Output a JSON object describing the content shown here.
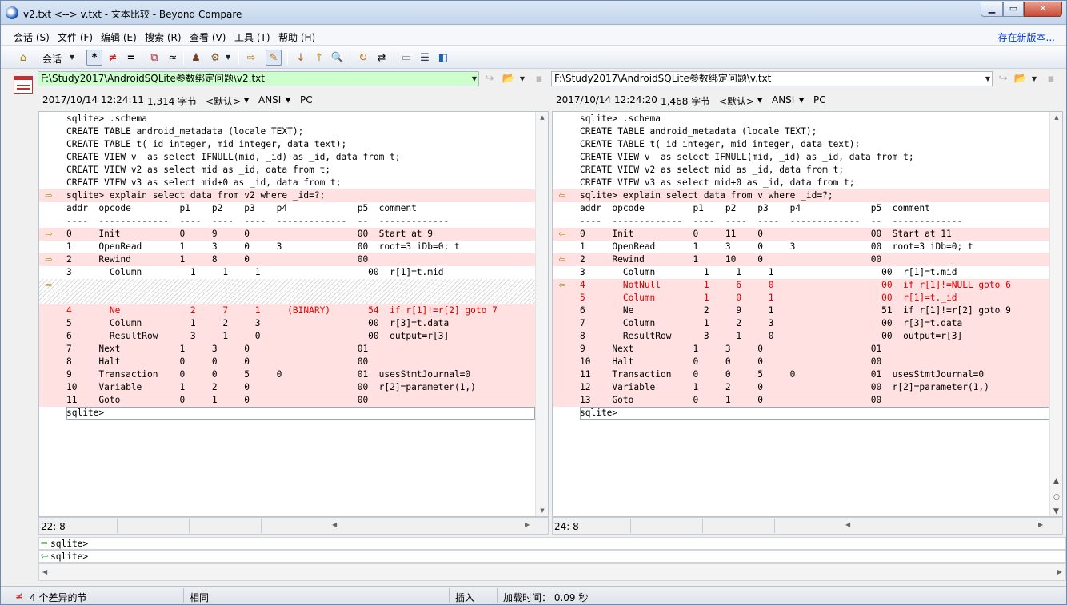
{
  "window": {
    "title": "v2.txt <--> v.txt - 文本比较 - Beyond Compare",
    "minimize": "▁",
    "maximize": "▭",
    "close": "✕"
  },
  "menu": {
    "items": [
      "会话 (S)",
      "文件 (F)",
      "编辑 (E)",
      "搜索 (R)",
      "查看 (V)",
      "工具 (T)",
      "帮助 (H)"
    ],
    "update_link": "存在新版本..."
  },
  "toolbar": {
    "session_label": "会话"
  },
  "left": {
    "path": "F:\\Study2017\\AndroidSQLite参数绑定问题\\v2.txt",
    "date": "2017/10/14 12:24:11",
    "size": "1,314 字节",
    "format": "<默认>",
    "encoding": "ANSI",
    "lineend": "PC",
    "cursor": "22: 8",
    "lines": [
      {
        "text": "sqlite> .schema",
        "cls": "",
        "arrow": ""
      },
      {
        "text": "CREATE TABLE android_metadata (locale TEXT);",
        "cls": "",
        "arrow": ""
      },
      {
        "text": "CREATE TABLE t(_id integer, mid integer, data text);",
        "cls": "",
        "arrow": ""
      },
      {
        "text": "CREATE VIEW v  as select IFNULL(mid, _id) as _id, data from t;",
        "cls": "",
        "arrow": ""
      },
      {
        "text": "CREATE VIEW v2 as select mid as _id, data from t;",
        "cls": "",
        "arrow": ""
      },
      {
        "text": "CREATE VIEW v3 as select mid+0 as _id, data from t;",
        "cls": "",
        "arrow": ""
      },
      {
        "text": "sqlite> explain select data from v2 where _id=?;",
        "cls": "diff",
        "arrow": "⇨"
      },
      {
        "text": "addr  opcode         p1    p2    p3    p4             p5  comment",
        "cls": "",
        "arrow": ""
      },
      {
        "text": "----  -------------  ----  ----  ----  -------------  --  -------------",
        "cls": "",
        "arrow": ""
      },
      {
        "text": "0     Init           0     9     0                    00  Start at 9",
        "cls": "diff",
        "arrow": "⇨"
      },
      {
        "text": "1     OpenRead       1     3     0     3              00  root=3 iDb=0; t",
        "cls": "",
        "arrow": ""
      },
      {
        "text": "2     Rewind         1     8     0                    00",
        "cls": "diff",
        "arrow": "⇨"
      },
      {
        "text": "3       Column         1     1     1                    00  r[1]=t.mid",
        "cls": "",
        "arrow": ""
      },
      {
        "text": "",
        "cls": "hatch",
        "arrow": "⇨"
      },
      {
        "text": "",
        "cls": "hatch",
        "arrow": ""
      },
      {
        "text": "4       Ne             2     7     1     (BINARY)       54  if r[1]!=r[2] goto 7",
        "cls": "diff red",
        "arrow": ""
      },
      {
        "text": "5       Column         1     2     3                    00  r[3]=t.data",
        "cls": "diff",
        "arrow": ""
      },
      {
        "text": "6       ResultRow      3     1     0                    00  output=r[3]",
        "cls": "diff",
        "arrow": ""
      },
      {
        "text": "7     Next           1     3     0                    01",
        "cls": "diff",
        "arrow": ""
      },
      {
        "text": "8     Halt           0     0     0                    00",
        "cls": "diff",
        "arrow": ""
      },
      {
        "text": "9     Transaction    0     0     5     0              01  usesStmtJournal=0",
        "cls": "diff",
        "arrow": ""
      },
      {
        "text": "10    Variable       1     2     0                    00  r[2]=parameter(1,)",
        "cls": "diff",
        "arrow": ""
      },
      {
        "text": "11    Goto           0     1     0                    00",
        "cls": "diff",
        "arrow": ""
      },
      {
        "text": "sqlite>",
        "cls": "cur",
        "arrow": ""
      }
    ]
  },
  "right": {
    "path": "F:\\Study2017\\AndroidSQLite参数绑定问题\\v.txt",
    "date": "2017/10/14 12:24:20",
    "size": "1,468 字节",
    "format": "<默认>",
    "encoding": "ANSI",
    "lineend": "PC",
    "cursor": "24: 8",
    "lines": [
      {
        "text": "sqlite> .schema",
        "cls": "",
        "arrow": ""
      },
      {
        "text": "CREATE TABLE android_metadata (locale TEXT);",
        "cls": "",
        "arrow": ""
      },
      {
        "text": "CREATE TABLE t(_id integer, mid integer, data text);",
        "cls": "",
        "arrow": ""
      },
      {
        "text": "CREATE VIEW v  as select IFNULL(mid, _id) as _id, data from t;",
        "cls": "",
        "arrow": ""
      },
      {
        "text": "CREATE VIEW v2 as select mid as _id, data from t;",
        "cls": "",
        "arrow": ""
      },
      {
        "text": "CREATE VIEW v3 as select mid+0 as _id, data from t;",
        "cls": "",
        "arrow": ""
      },
      {
        "text": "sqlite> explain select data from v where _id=?;",
        "cls": "diff",
        "arrow": "⇦"
      },
      {
        "text": "addr  opcode         p1    p2    p3    p4             p5  comment",
        "cls": "",
        "arrow": ""
      },
      {
        "text": "----  -------------  ----  ----  ----  -------------  --  -------------",
        "cls": "",
        "arrow": ""
      },
      {
        "text": "0     Init           0     11    0                    00  Start at 11",
        "cls": "diff",
        "arrow": "⇦"
      },
      {
        "text": "1     OpenRead       1     3     0     3              00  root=3 iDb=0; t",
        "cls": "",
        "arrow": ""
      },
      {
        "text": "2     Rewind         1     10    0                    00",
        "cls": "diff",
        "arrow": "⇦"
      },
      {
        "text": "3       Column         1     1     1                    00  r[1]=t.mid",
        "cls": "",
        "arrow": ""
      },
      {
        "text": "4       NotNull        1     6     0                    00  if r[1]!=NULL goto 6",
        "cls": "diff red",
        "arrow": "⇦"
      },
      {
        "text": "5       Column         1     0     1                    00  r[1]=t._id",
        "cls": "diff red",
        "arrow": ""
      },
      {
        "text": "6       Ne             2     9     1                    51  if r[1]!=r[2] goto 9",
        "cls": "diff",
        "arrow": ""
      },
      {
        "text": "7       Column         1     2     3                    00  r[3]=t.data",
        "cls": "diff",
        "arrow": ""
      },
      {
        "text": "8       ResultRow      3     1     0                    00  output=r[3]",
        "cls": "diff",
        "arrow": ""
      },
      {
        "text": "9     Next           1     3     0                    01",
        "cls": "diff",
        "arrow": ""
      },
      {
        "text": "10    Halt           0     0     0                    00",
        "cls": "diff",
        "arrow": ""
      },
      {
        "text": "11    Transaction    0     0     5     0              01  usesStmtJournal=0",
        "cls": "diff",
        "arrow": ""
      },
      {
        "text": "12    Variable       1     2     0                    00  r[2]=parameter(1,)",
        "cls": "diff",
        "arrow": ""
      },
      {
        "text": "13    Goto           0     1     0                    00",
        "cls": "diff",
        "arrow": ""
      },
      {
        "text": "sqlite>",
        "cls": "cur",
        "arrow": ""
      }
    ]
  },
  "compare": {
    "line1": "sqlite>",
    "line2": "sqlite>"
  },
  "status": {
    "diffs": "4 个差异的节",
    "same": "相同",
    "mode": "插入",
    "loadtime": "加载时间： 0.09 秒"
  },
  "colors": {
    "diff_bg": "#ffe1e1",
    "diff_text": "#e00000",
    "path_highlight": "#ccffcc",
    "link": "#0033cc"
  }
}
